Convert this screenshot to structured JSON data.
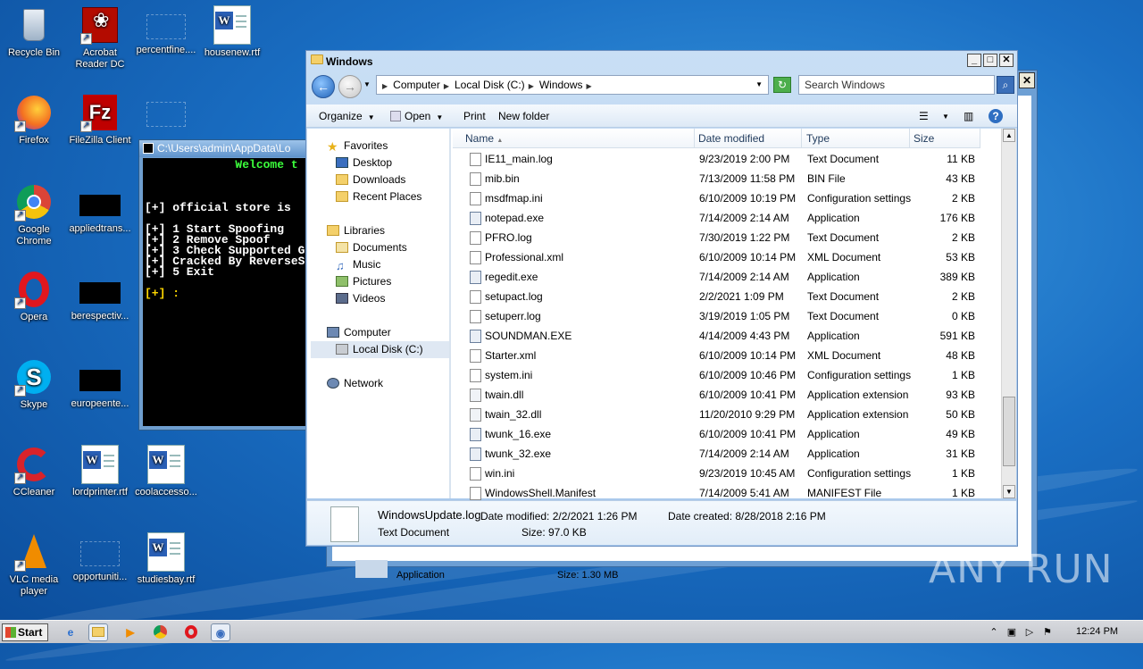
{
  "desktop": {
    "icons": [
      {
        "label": "Recycle Bin"
      },
      {
        "label": "Acrobat Reader DC"
      },
      {
        "label": "percentfine...."
      },
      {
        "label": "housenew.rtf"
      },
      {
        "label": "Firefox"
      },
      {
        "label": "FileZilla Client"
      },
      {
        "label": "Google Chrome"
      },
      {
        "label": "appliedtrans..."
      },
      {
        "label": "Opera"
      },
      {
        "label": "berespectiv..."
      },
      {
        "label": "Skype"
      },
      {
        "label": "europeente..."
      },
      {
        "label": "CCleaner"
      },
      {
        "label": "lordprinter.rtf"
      },
      {
        "label": "coolaccesso..."
      },
      {
        "label": "VLC media player"
      },
      {
        "label": "opportuniti..."
      },
      {
        "label": "studiesbay.rtf"
      }
    ]
  },
  "console": {
    "title": "C:\\Users\\admin\\AppData\\Lo",
    "lines": {
      "welcome": "             Welcome t",
      "store": "[+] official store is ",
      "opt1": "[+] 1 Start Spoofing",
      "opt2": "[+] 2 Remove Spoof",
      "opt3": "[+] 3 Check Supported G",
      "cracked": "[+] Cracked By ReverseS",
      "opt5": "[+] 5 Exit",
      "prompt": "[+] :"
    }
  },
  "explorer": {
    "title": "Windows",
    "address": [
      "Computer",
      "Local Disk (C:)",
      "Windows"
    ],
    "search_placeholder": "Search Windows",
    "toolbar": {
      "organize": "Organize",
      "open": "Open",
      "print": "Print",
      "new_folder": "New folder"
    },
    "nav": {
      "favorites": "Favorites",
      "desktop": "Desktop",
      "downloads": "Downloads",
      "recent": "Recent Places",
      "libraries": "Libraries",
      "documents": "Documents",
      "music": "Music",
      "pictures": "Pictures",
      "videos": "Videos",
      "computer": "Computer",
      "localdisk": "Local Disk (C:)",
      "network": "Network"
    },
    "columns": {
      "name": "Name",
      "date": "Date modified",
      "type": "Type",
      "size": "Size"
    },
    "files": [
      {
        "name": "IE11_main.log",
        "date": "9/23/2019 2:00 PM",
        "type": "Text Document",
        "size": "11 KB"
      },
      {
        "name": "mib.bin",
        "date": "7/13/2009 11:58 PM",
        "type": "BIN File",
        "size": "43 KB"
      },
      {
        "name": "msdfmap.ini",
        "date": "6/10/2009 10:19 PM",
        "type": "Configuration settings",
        "size": "2 KB"
      },
      {
        "name": "notepad.exe",
        "date": "7/14/2009 2:14 AM",
        "type": "Application",
        "size": "176 KB"
      },
      {
        "name": "PFRO.log",
        "date": "7/30/2019 1:22 PM",
        "type": "Text Document",
        "size": "2 KB"
      },
      {
        "name": "Professional.xml",
        "date": "6/10/2009 10:14 PM",
        "type": "XML Document",
        "size": "53 KB"
      },
      {
        "name": "regedit.exe",
        "date": "7/14/2009 2:14 AM",
        "type": "Application",
        "size": "389 KB"
      },
      {
        "name": "setupact.log",
        "date": "2/2/2021 1:09 PM",
        "type": "Text Document",
        "size": "2 KB"
      },
      {
        "name": "setuperr.log",
        "date": "3/19/2019 1:05 PM",
        "type": "Text Document",
        "size": "0 KB"
      },
      {
        "name": "SOUNDMAN.EXE",
        "date": "4/14/2009 4:43 PM",
        "type": "Application",
        "size": "591 KB"
      },
      {
        "name": "Starter.xml",
        "date": "6/10/2009 10:14 PM",
        "type": "XML Document",
        "size": "48 KB"
      },
      {
        "name": "system.ini",
        "date": "6/10/2009 10:46 PM",
        "type": "Configuration settings",
        "size": "1 KB"
      },
      {
        "name": "twain.dll",
        "date": "6/10/2009 10:41 PM",
        "type": "Application extension",
        "size": "93 KB"
      },
      {
        "name": "twain_32.dll",
        "date": "11/20/2010 9:29 PM",
        "type": "Application extension",
        "size": "50 KB"
      },
      {
        "name": "twunk_16.exe",
        "date": "6/10/2009 10:41 PM",
        "type": "Application",
        "size": "49 KB"
      },
      {
        "name": "twunk_32.exe",
        "date": "7/14/2009 2:14 AM",
        "type": "Application",
        "size": "31 KB"
      },
      {
        "name": "win.ini",
        "date": "9/23/2019 10:45 AM",
        "type": "Configuration settings",
        "size": "1 KB"
      },
      {
        "name": "WindowsShell.Manifest",
        "date": "7/14/2009 5:41 AM",
        "type": "MANIFEST File",
        "size": "1 KB"
      }
    ],
    "details": {
      "filename": "WindowsUpdate.log",
      "modified": "Date modified: 2/2/2021 1:26 PM",
      "created": "Date created: 8/28/2018 2:16 PM",
      "type": "Text Document",
      "size": "Size: 97.0 KB"
    }
  },
  "backwindow": {
    "type_text": "Application",
    "size_text": "Size: 1.30 MB"
  },
  "taskbar": {
    "start": "Start",
    "clock": "12:24 PM"
  },
  "watermark": "ANY RUN"
}
